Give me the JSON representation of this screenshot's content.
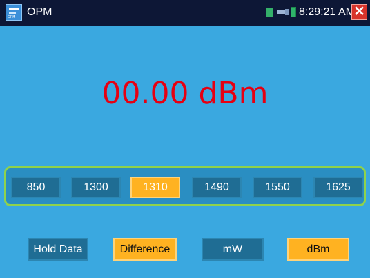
{
  "statusbar": {
    "app_title": "OPM",
    "app_icon_caption": "OPM",
    "time": "8:29:21 AM",
    "close_glyph": "✕",
    "icons": [
      "sd-card-icon",
      "usb-icon",
      "battery-icon"
    ]
  },
  "reading": {
    "value": "00.00 dBm",
    "color": "#e60012"
  },
  "wavelengths": [
    "850",
    "1300",
    "1310",
    "1490",
    "1550",
    "1625"
  ],
  "selected_wavelength": "1310",
  "controls": {
    "hold_data": "Hold Data",
    "difference": "Difference",
    "mw": "mW",
    "dbm": "dBm"
  },
  "colors": {
    "background": "#3aa8e0",
    "active": "#ffb221",
    "inactive": "#1f6d94",
    "strip_border": "#8fd24b"
  }
}
